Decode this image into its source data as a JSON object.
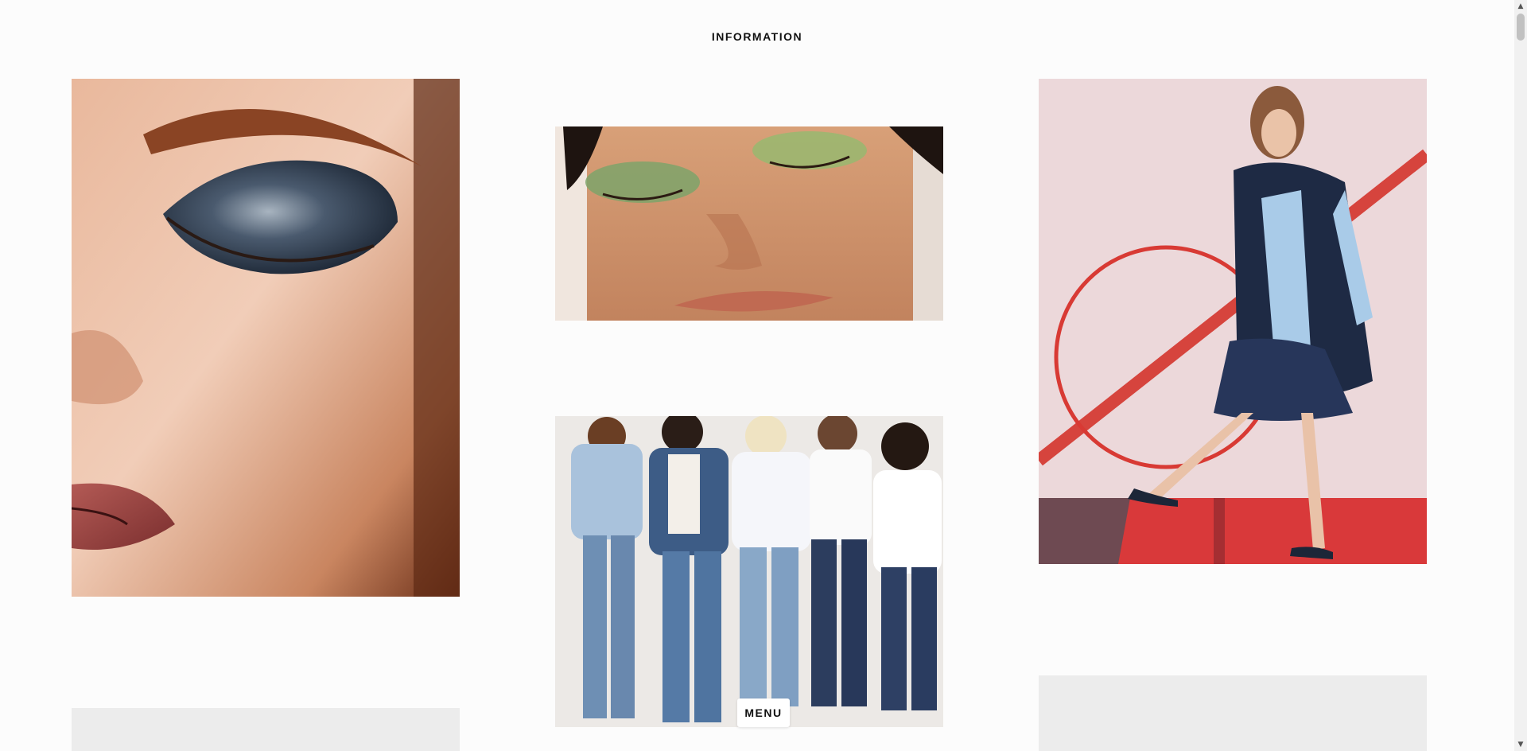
{
  "header": {
    "nav_label": "INFORMATION"
  },
  "gallery": {
    "tiles": [
      {
        "name": "glitter-eyeshadow-closeup",
        "kind": "photo"
      },
      {
        "name": "green-eyeshadow-smile",
        "kind": "photo"
      },
      {
        "name": "women-in-denim-group",
        "kind": "photo"
      },
      {
        "name": "fashion-model-red-hoop",
        "kind": "photo"
      }
    ]
  },
  "footer": {
    "menu_label": "MENU"
  },
  "colors": {
    "background": "#fcfcfc",
    "placeholder": "#ececec",
    "text": "#111111"
  },
  "icons": {
    "scroll_up": "chevron-up-icon",
    "scroll_down": "chevron-down-icon"
  }
}
